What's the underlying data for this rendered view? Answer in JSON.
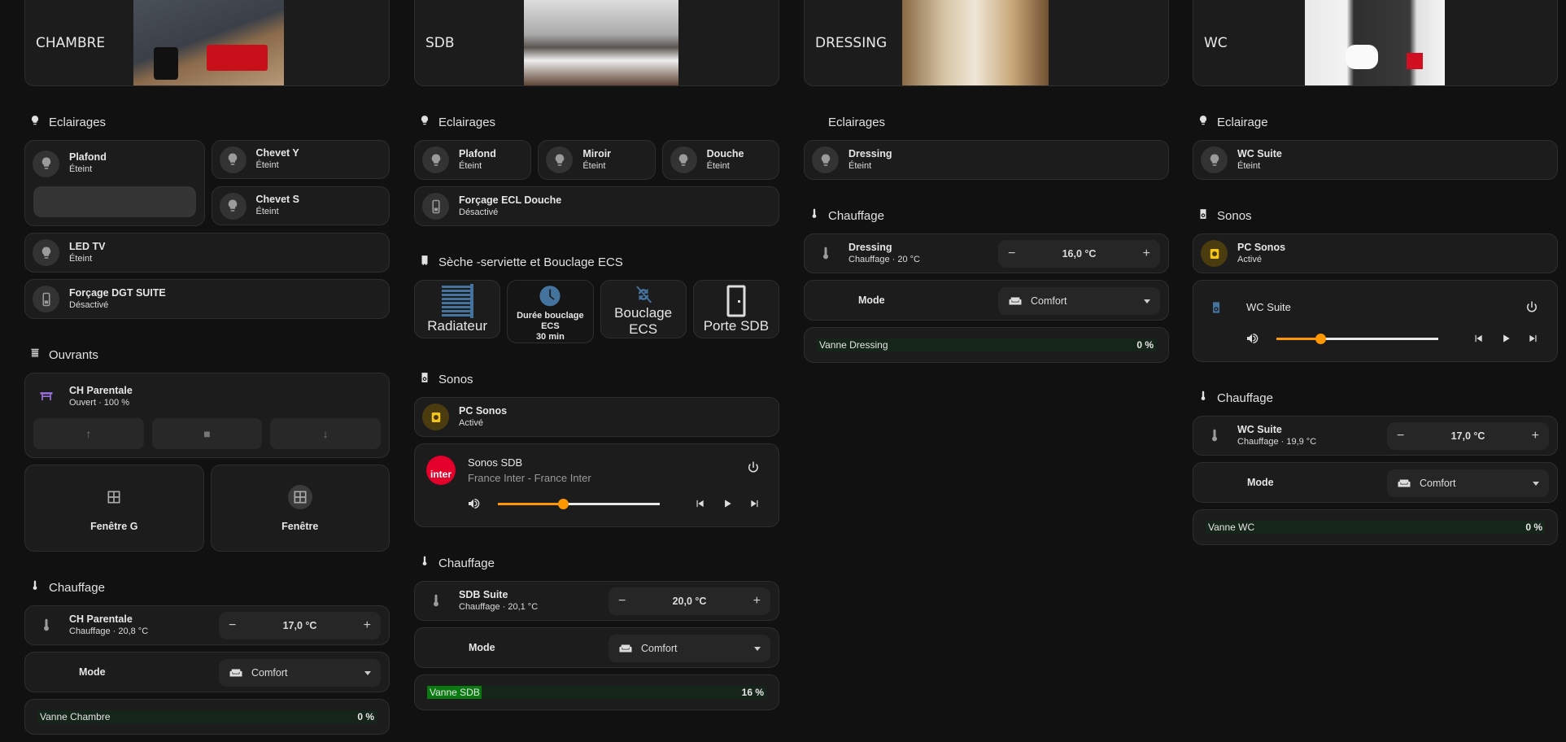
{
  "colors": {
    "accent": "#ff9800",
    "heat": "#ff6f22",
    "valve_fill": "#0a7a10",
    "plug": "#f5c518",
    "cover": "#9b6fe0",
    "tile_blue": "#44739e"
  },
  "columns": [
    {
      "header": {
        "title": "CHAMBRE"
      },
      "sections": [
        {
          "title": "Eclairages",
          "icon": "bulb",
          "items": [
            {
              "type": "split",
              "big": {
                "name": "Plafond",
                "state": "Éteint",
                "icon": "bulb"
              },
              "stack": [
                {
                  "name": "Chevet Y",
                  "state": "Éteint",
                  "icon": "bulb"
                },
                {
                  "name": "Chevet S",
                  "state": "Éteint",
                  "icon": "bulb"
                }
              ]
            },
            {
              "type": "entity",
              "name": "LED TV",
              "state": "Éteint",
              "icon": "bulb"
            },
            {
              "type": "entity",
              "name": "Forçage DGT SUITE",
              "state": "Désactivé",
              "icon": "switch"
            }
          ]
        },
        {
          "title": "Ouvrants",
          "icon": "blind",
          "items": [
            {
              "type": "cover",
              "name": "CH Parentale",
              "state": "Ouvert · 100 %",
              "buttons": [
                "↑",
                "■",
                "↓"
              ]
            },
            {
              "type": "windows",
              "items": [
                {
                  "name": "Fenêtre G"
                },
                {
                  "name": "Fenêtre"
                }
              ]
            }
          ]
        },
        {
          "title": "Chauffage",
          "icon": "thermo",
          "items": [
            {
              "type": "thermo",
              "name": "CH Parentale",
              "state": "Chauffage · 20,8 °C",
              "target": "17,0 °C"
            },
            {
              "type": "select",
              "label": "Mode",
              "value": "Comfort"
            },
            {
              "type": "gauge",
              "name": "Vanne Chambre",
              "value_label": "0 %",
              "percent": 0
            }
          ]
        }
      ]
    },
    {
      "header": {
        "title": "SDB"
      },
      "sections": [
        {
          "title": "Eclairages",
          "icon": "bulb",
          "items": [
            {
              "type": "row",
              "items": [
                {
                  "name": "Plafond",
                  "state": "Éteint",
                  "icon": "bulb"
                },
                {
                  "name": "Miroir",
                  "state": "Éteint",
                  "icon": "bulb"
                },
                {
                  "name": "Douche",
                  "state": "Éteint",
                  "icon": "bulb"
                }
              ]
            },
            {
              "type": "entity",
              "name": "Forçage ECL Douche",
              "state": "Désactivé",
              "icon": "switch"
            }
          ]
        },
        {
          "title": "Sèche -serviette et Bouclage ECS",
          "icon": "radiator",
          "items": [
            {
              "type": "tiles",
              "items": [
                {
                  "label": "Radiateur",
                  "icon": "towel"
                },
                {
                  "label": "Durée bouclage ECS",
                  "sublabel": "30 min",
                  "icon": "clock"
                },
                {
                  "label": "Bouclage ECS",
                  "icon": "sync-off"
                },
                {
                  "label": "Porte SDB",
                  "icon": "door"
                }
              ]
            }
          ]
        },
        {
          "title": "Sonos",
          "icon": "speaker",
          "items": [
            {
              "type": "plug",
              "name": "PC Sonos",
              "state": "Activé"
            },
            {
              "type": "media",
              "name": "Sonos SDB",
              "subtitle": "France Inter - France Inter",
              "art": "inter",
              "volume": 0.4
            }
          ]
        },
        {
          "title": "Chauffage",
          "icon": "thermo",
          "items": [
            {
              "type": "thermo",
              "name": "SDB Suite",
              "state": "Chauffage · 20,1 °C",
              "target": "20,0 °C"
            },
            {
              "type": "select",
              "label": "Mode",
              "value": "Comfort"
            },
            {
              "type": "gauge",
              "name": "Vanne SDB",
              "value_label": "16 %",
              "percent": 16
            }
          ]
        }
      ]
    },
    {
      "header": {
        "title": "DRESSING"
      },
      "sections": [
        {
          "title": "Eclairages",
          "icon": "",
          "items": [
            {
              "type": "entity",
              "name": "Dressing",
              "state": "Éteint",
              "icon": "bulb"
            }
          ]
        },
        {
          "title": "Chauffage",
          "icon": "thermo",
          "items": [
            {
              "type": "thermo",
              "name": "Dressing",
              "state": "Chauffage · 20 °C",
              "target": "16,0 °C"
            },
            {
              "type": "select",
              "label": "Mode",
              "value": "Comfort"
            },
            {
              "type": "gauge",
              "name": "Vanne Dressing",
              "value_label": "0 %",
              "percent": 0
            }
          ]
        }
      ]
    },
    {
      "header": {
        "title": "WC"
      },
      "sections": [
        {
          "title": "Eclairage",
          "icon": "bulb",
          "items": [
            {
              "type": "entity",
              "name": "WC Suite",
              "state": "Éteint",
              "icon": "bulb"
            }
          ]
        },
        {
          "title": "Sonos",
          "icon": "speaker",
          "items": [
            {
              "type": "plug",
              "name": "PC Sonos",
              "state": "Activé"
            },
            {
              "type": "media",
              "name": "WC Suite",
              "art": "speaker",
              "volume": 0.27
            }
          ]
        },
        {
          "title": "Chauffage",
          "icon": "thermo",
          "items": [
            {
              "type": "thermo",
              "name": "WC Suite",
              "state": "Chauffage · 19,9 °C",
              "target": "17,0 °C"
            },
            {
              "type": "select",
              "label": "Mode",
              "value": "Comfort"
            },
            {
              "type": "gauge",
              "name": "Vanne WC",
              "value_label": "0 %",
              "percent": 0
            }
          ]
        }
      ]
    }
  ]
}
